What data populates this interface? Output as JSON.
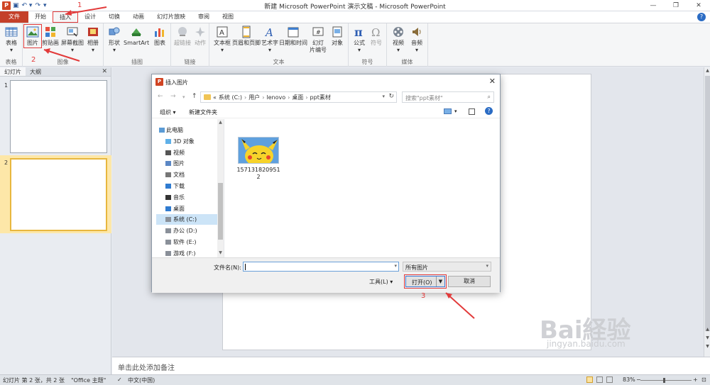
{
  "window": {
    "title": "新建 Microsoft PowerPoint 演示文稿 - Microsoft PowerPoint",
    "app_icon": "P"
  },
  "tabs": [
    "文件",
    "开始",
    "插入",
    "设计",
    "切换",
    "动画",
    "幻灯片放映",
    "审阅",
    "视图"
  ],
  "ribbon": {
    "table": "表格",
    "picture": "图片",
    "clipart": "剪贴画",
    "screenshot": "屏幕截图",
    "album": "相册",
    "shapes": "形状",
    "smartart": "SmartArt",
    "chart": "图表",
    "hyperlink": "超链接",
    "action": "动作",
    "textbox": "文本框",
    "header_footer": "页眉和页脚",
    "wordart": "艺术字",
    "datetime": "日期和时间",
    "slide_number": "幻灯\n片编号",
    "object": "对象",
    "equation": "公式",
    "symbol": "符号",
    "video": "视频",
    "audio": "音频",
    "groups": {
      "tables": "表格",
      "images": "图像",
      "illustrations": "插图",
      "links": "链接",
      "text": "文本",
      "symbols": "符号",
      "media": "媒体"
    }
  },
  "left_pane": {
    "tab_slides": "幻灯片",
    "tab_outline": "大纲",
    "close": "✕",
    "slide1_num": "1",
    "slide2_num": "2"
  },
  "notes_placeholder": "单击此处添加备注",
  "status": {
    "slide": "幻灯片 第 2 张，共 2 张",
    "theme": "\"Office 主题\"",
    "language": "中文(中国)",
    "zoom": "83%"
  },
  "dialog": {
    "title": "插入图片",
    "breadcrumbs": [
      "«",
      "系统 (C:)",
      "用户",
      "lenovo",
      "桌面",
      "ppt素材"
    ],
    "search_placeholder": "搜索\"ppt素材\"",
    "organize": "组织 ▾",
    "new_folder": "新建文件夹",
    "nav_items": [
      {
        "label": "此电脑",
        "icon": "computer-icon"
      },
      {
        "label": "3D 对象",
        "icon": "cube-icon"
      },
      {
        "label": "视频",
        "icon": "video-icon"
      },
      {
        "label": "图片",
        "icon": "picture-icon"
      },
      {
        "label": "文档",
        "icon": "document-icon"
      },
      {
        "label": "下载",
        "icon": "download-icon"
      },
      {
        "label": "音乐",
        "icon": "music-icon"
      },
      {
        "label": "桌面",
        "icon": "desktop-icon"
      },
      {
        "label": "系统 (C:)",
        "icon": "drive-icon"
      },
      {
        "label": "办公 (D:)",
        "icon": "drive-icon"
      },
      {
        "label": "软件 (E:)",
        "icon": "drive-icon"
      },
      {
        "label": "游戏 (F:)",
        "icon": "drive-icon"
      }
    ],
    "file_name_line1": "157131820951",
    "file_name_line2": "2",
    "filename_label": "文件名(N):",
    "filename_value": "",
    "filetype": "所有图片",
    "tools": "工具(L)  ▾",
    "open": "打开(O)",
    "cancel": "取消"
  },
  "annotations": {
    "one": "1",
    "two": "2",
    "three": "3"
  },
  "watermark": {
    "brand": "Bai経验",
    "url": "jingyan.baidu.com"
  },
  "colors": {
    "file_tab": "#c4402a",
    "annotation": "#e23a3a",
    "accent": "#2b579a"
  }
}
